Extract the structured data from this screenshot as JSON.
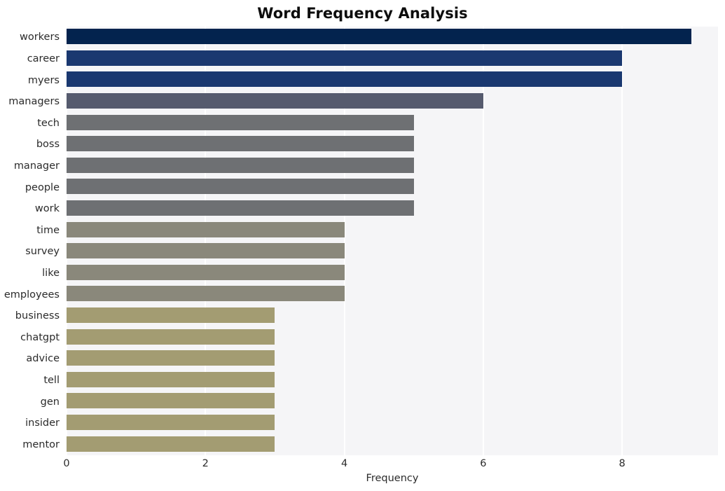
{
  "chart_data": {
    "type": "bar",
    "orientation": "horizontal",
    "title": "Word Frequency Analysis",
    "xlabel": "Frequency",
    "ylabel": "",
    "categories": [
      "workers",
      "career",
      "myers",
      "managers",
      "tech",
      "boss",
      "manager",
      "people",
      "work",
      "time",
      "survey",
      "like",
      "employees",
      "business",
      "chatgpt",
      "advice",
      "tell",
      "gen",
      "insider",
      "mentor"
    ],
    "values": [
      9,
      8,
      8,
      6,
      5,
      5,
      5,
      5,
      5,
      4,
      4,
      4,
      4,
      3,
      3,
      3,
      3,
      3,
      3,
      3
    ],
    "bar_colors": [
      "#03234e",
      "#1a3870",
      "#1a3870",
      "#565b6e",
      "#6e7073",
      "#6e7073",
      "#6e7073",
      "#6e7073",
      "#6e7073",
      "#8a887b",
      "#8a887b",
      "#8a887b",
      "#8a887b",
      "#a39c72",
      "#a39c72",
      "#a39c72",
      "#a39c72",
      "#a39c72",
      "#a39c72",
      "#a39c72"
    ],
    "xticks": [
      0,
      2,
      4,
      6,
      8
    ],
    "xtick_labels": [
      "0",
      "2",
      "4",
      "6",
      "8"
    ],
    "xlim": [
      0,
      9.38
    ],
    "grid": true,
    "grid_axis": "x",
    "legend": null,
    "plot_background": "#f5f5f7",
    "figure_background": "#ffffff",
    "gridline_color": "#ffffff",
    "title_color": "#0d0d0d",
    "tick_label_color": "#2b2b2b"
  }
}
